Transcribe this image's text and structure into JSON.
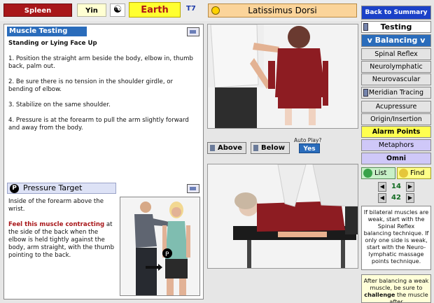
{
  "topbar": {
    "meridian": "Spleen",
    "polarity": "Yin",
    "element": "Earth",
    "code": "T7",
    "muscle": "Latissimus Dorsi"
  },
  "testing": {
    "heading": "Muscle Testing",
    "position": "Standing or Lying Face Up",
    "steps": [
      "1. Position the straight arm beside the body, elbow in, thumb back, palm out.",
      "2. Be sure there is no tension in the shoulder girdle, or bending of elbow.",
      "3. Stabilize on the same shoulder.",
      "4. Pressure is at the forearm to pull the arm slightly forward and away from the body."
    ]
  },
  "pressure": {
    "badge": "P",
    "heading": "Pressure Target",
    "location": "Inside of the forearm above the wrist.",
    "feel_title": "Feel this muscle contracting",
    "feel_text": "at the side of the back when the elbow is held tightly against the body, arm straight, with the thumb pointing to the back."
  },
  "media": {
    "above_label": "Above",
    "below_label": "Below",
    "autoplay_label": "Auto Play?",
    "autoplay_value": "Yes"
  },
  "sidebar": {
    "back": "Back to Summary",
    "testing": "Testing",
    "balancing": "v Balancing v",
    "items": [
      "Spinal Reflex",
      "Neurolymphatic",
      "Neurovascular",
      "Meridian Tracing",
      "Acupressure",
      "Origin/Insertion",
      "Alarm Points",
      "Metaphors",
      "Omni"
    ],
    "list": "List",
    "find": "Find",
    "page_current": "14",
    "page_total": "42"
  },
  "notes": {
    "bilateral": "If bilateral muscles are weak, start with the Spinal Reflex balancing technique. If only one side is weak, start with the Neuro-lymphatic massage points technique.",
    "challenge_pre": "After balancing a weak muscle, be sure to",
    "challenge_bold": "challenge",
    "challenge_post": "the muscle after"
  }
}
